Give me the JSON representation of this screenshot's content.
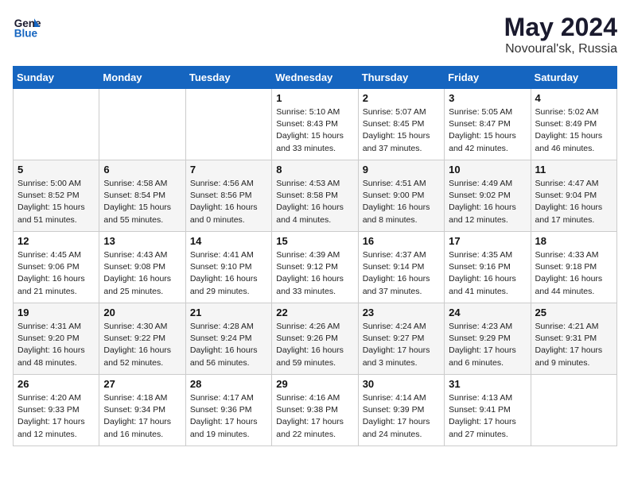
{
  "header": {
    "logo_line1": "General",
    "logo_line2": "Blue",
    "month": "May 2024",
    "location": "Novoural'sk, Russia"
  },
  "weekdays": [
    "Sunday",
    "Monday",
    "Tuesday",
    "Wednesday",
    "Thursday",
    "Friday",
    "Saturday"
  ],
  "weeks": [
    [
      {
        "day": "",
        "sunrise": "",
        "sunset": "",
        "daylight": ""
      },
      {
        "day": "",
        "sunrise": "",
        "sunset": "",
        "daylight": ""
      },
      {
        "day": "",
        "sunrise": "",
        "sunset": "",
        "daylight": ""
      },
      {
        "day": "1",
        "sunrise": "Sunrise: 5:10 AM",
        "sunset": "Sunset: 8:43 PM",
        "daylight": "Daylight: 15 hours and 33 minutes."
      },
      {
        "day": "2",
        "sunrise": "Sunrise: 5:07 AM",
        "sunset": "Sunset: 8:45 PM",
        "daylight": "Daylight: 15 hours and 37 minutes."
      },
      {
        "day": "3",
        "sunrise": "Sunrise: 5:05 AM",
        "sunset": "Sunset: 8:47 PM",
        "daylight": "Daylight: 15 hours and 42 minutes."
      },
      {
        "day": "4",
        "sunrise": "Sunrise: 5:02 AM",
        "sunset": "Sunset: 8:49 PM",
        "daylight": "Daylight: 15 hours and 46 minutes."
      }
    ],
    [
      {
        "day": "5",
        "sunrise": "Sunrise: 5:00 AM",
        "sunset": "Sunset: 8:52 PM",
        "daylight": "Daylight: 15 hours and 51 minutes."
      },
      {
        "day": "6",
        "sunrise": "Sunrise: 4:58 AM",
        "sunset": "Sunset: 8:54 PM",
        "daylight": "Daylight: 15 hours and 55 minutes."
      },
      {
        "day": "7",
        "sunrise": "Sunrise: 4:56 AM",
        "sunset": "Sunset: 8:56 PM",
        "daylight": "Daylight: 16 hours and 0 minutes."
      },
      {
        "day": "8",
        "sunrise": "Sunrise: 4:53 AM",
        "sunset": "Sunset: 8:58 PM",
        "daylight": "Daylight: 16 hours and 4 minutes."
      },
      {
        "day": "9",
        "sunrise": "Sunrise: 4:51 AM",
        "sunset": "Sunset: 9:00 PM",
        "daylight": "Daylight: 16 hours and 8 minutes."
      },
      {
        "day": "10",
        "sunrise": "Sunrise: 4:49 AM",
        "sunset": "Sunset: 9:02 PM",
        "daylight": "Daylight: 16 hours and 12 minutes."
      },
      {
        "day": "11",
        "sunrise": "Sunrise: 4:47 AM",
        "sunset": "Sunset: 9:04 PM",
        "daylight": "Daylight: 16 hours and 17 minutes."
      }
    ],
    [
      {
        "day": "12",
        "sunrise": "Sunrise: 4:45 AM",
        "sunset": "Sunset: 9:06 PM",
        "daylight": "Daylight: 16 hours and 21 minutes."
      },
      {
        "day": "13",
        "sunrise": "Sunrise: 4:43 AM",
        "sunset": "Sunset: 9:08 PM",
        "daylight": "Daylight: 16 hours and 25 minutes."
      },
      {
        "day": "14",
        "sunrise": "Sunrise: 4:41 AM",
        "sunset": "Sunset: 9:10 PM",
        "daylight": "Daylight: 16 hours and 29 minutes."
      },
      {
        "day": "15",
        "sunrise": "Sunrise: 4:39 AM",
        "sunset": "Sunset: 9:12 PM",
        "daylight": "Daylight: 16 hours and 33 minutes."
      },
      {
        "day": "16",
        "sunrise": "Sunrise: 4:37 AM",
        "sunset": "Sunset: 9:14 PM",
        "daylight": "Daylight: 16 hours and 37 minutes."
      },
      {
        "day": "17",
        "sunrise": "Sunrise: 4:35 AM",
        "sunset": "Sunset: 9:16 PM",
        "daylight": "Daylight: 16 hours and 41 minutes."
      },
      {
        "day": "18",
        "sunrise": "Sunrise: 4:33 AM",
        "sunset": "Sunset: 9:18 PM",
        "daylight": "Daylight: 16 hours and 44 minutes."
      }
    ],
    [
      {
        "day": "19",
        "sunrise": "Sunrise: 4:31 AM",
        "sunset": "Sunset: 9:20 PM",
        "daylight": "Daylight: 16 hours and 48 minutes."
      },
      {
        "day": "20",
        "sunrise": "Sunrise: 4:30 AM",
        "sunset": "Sunset: 9:22 PM",
        "daylight": "Daylight: 16 hours and 52 minutes."
      },
      {
        "day": "21",
        "sunrise": "Sunrise: 4:28 AM",
        "sunset": "Sunset: 9:24 PM",
        "daylight": "Daylight: 16 hours and 56 minutes."
      },
      {
        "day": "22",
        "sunrise": "Sunrise: 4:26 AM",
        "sunset": "Sunset: 9:26 PM",
        "daylight": "Daylight: 16 hours and 59 minutes."
      },
      {
        "day": "23",
        "sunrise": "Sunrise: 4:24 AM",
        "sunset": "Sunset: 9:27 PM",
        "daylight": "Daylight: 17 hours and 3 minutes."
      },
      {
        "day": "24",
        "sunrise": "Sunrise: 4:23 AM",
        "sunset": "Sunset: 9:29 PM",
        "daylight": "Daylight: 17 hours and 6 minutes."
      },
      {
        "day": "25",
        "sunrise": "Sunrise: 4:21 AM",
        "sunset": "Sunset: 9:31 PM",
        "daylight": "Daylight: 17 hours and 9 minutes."
      }
    ],
    [
      {
        "day": "26",
        "sunrise": "Sunrise: 4:20 AM",
        "sunset": "Sunset: 9:33 PM",
        "daylight": "Daylight: 17 hours and 12 minutes."
      },
      {
        "day": "27",
        "sunrise": "Sunrise: 4:18 AM",
        "sunset": "Sunset: 9:34 PM",
        "daylight": "Daylight: 17 hours and 16 minutes."
      },
      {
        "day": "28",
        "sunrise": "Sunrise: 4:17 AM",
        "sunset": "Sunset: 9:36 PM",
        "daylight": "Daylight: 17 hours and 19 minutes."
      },
      {
        "day": "29",
        "sunrise": "Sunrise: 4:16 AM",
        "sunset": "Sunset: 9:38 PM",
        "daylight": "Daylight: 17 hours and 22 minutes."
      },
      {
        "day": "30",
        "sunrise": "Sunrise: 4:14 AM",
        "sunset": "Sunset: 9:39 PM",
        "daylight": "Daylight: 17 hours and 24 minutes."
      },
      {
        "day": "31",
        "sunrise": "Sunrise: 4:13 AM",
        "sunset": "Sunset: 9:41 PM",
        "daylight": "Daylight: 17 hours and 27 minutes."
      },
      {
        "day": "",
        "sunrise": "",
        "sunset": "",
        "daylight": ""
      }
    ]
  ]
}
